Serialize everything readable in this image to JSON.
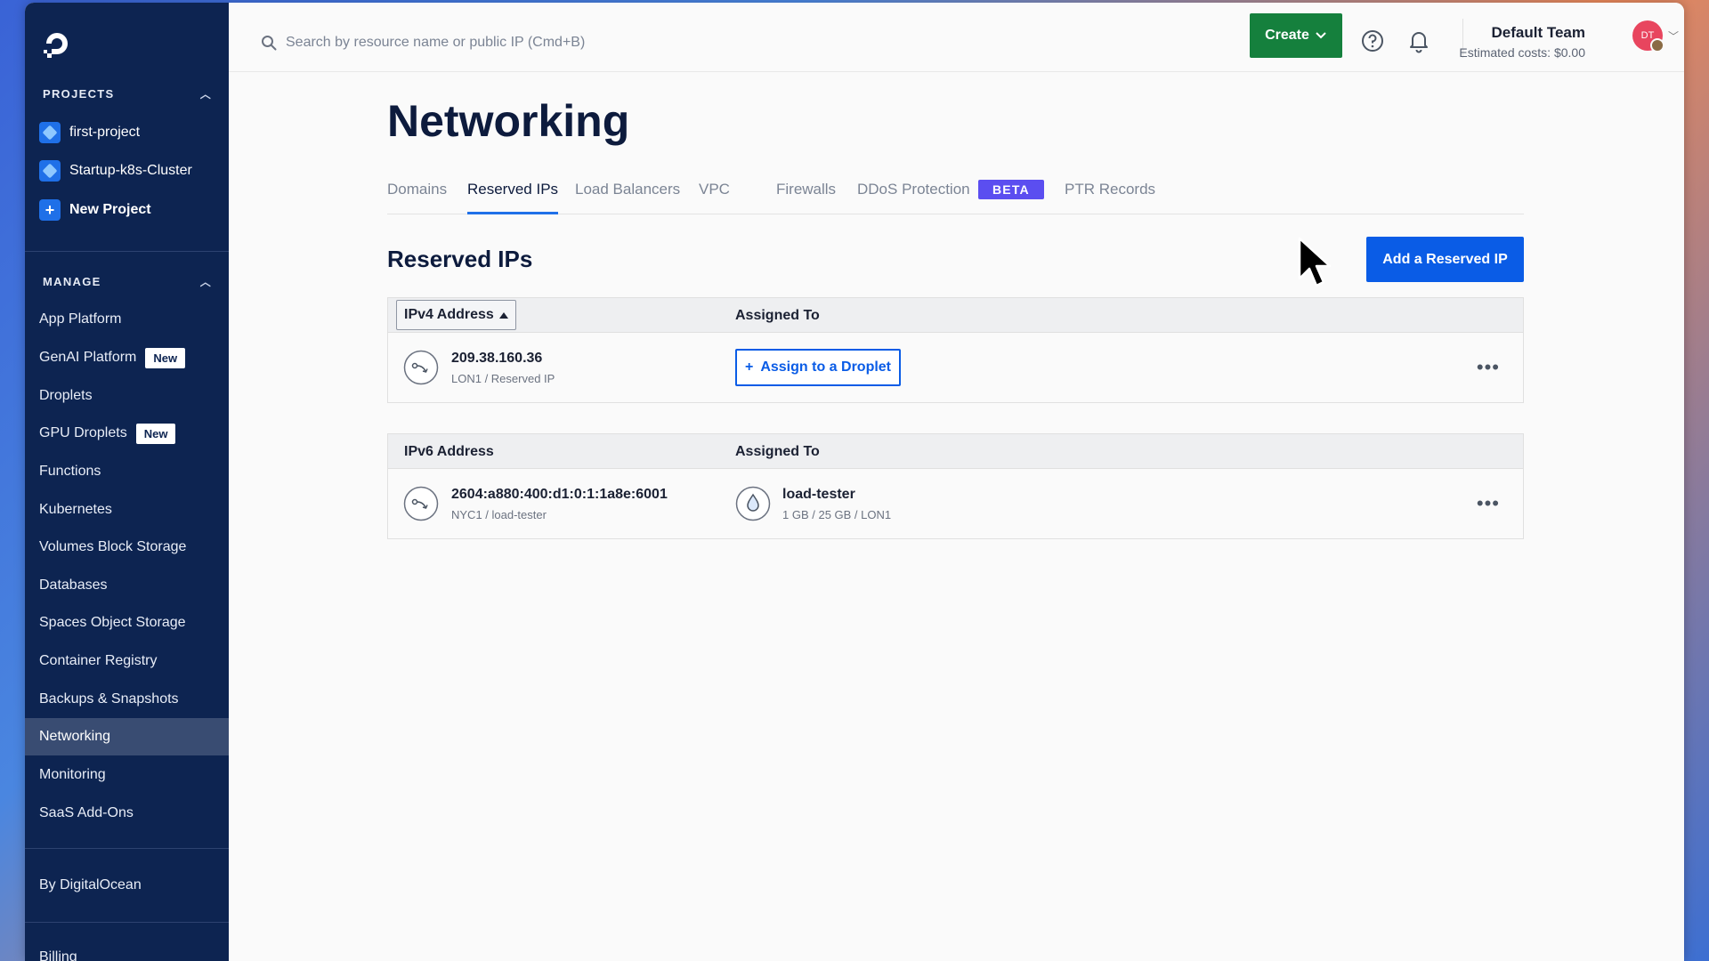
{
  "sidebar": {
    "projects_header": "PROJECTS",
    "projects": [
      {
        "label": "first-project"
      },
      {
        "label": "Startup-k8s-Cluster"
      }
    ],
    "new_project": "New Project",
    "manage_header": "MANAGE",
    "items": [
      {
        "label": "App Platform"
      },
      {
        "label": "GenAI Platform",
        "badge": "New"
      },
      {
        "label": "Droplets"
      },
      {
        "label": "GPU Droplets",
        "badge": "New"
      },
      {
        "label": "Functions"
      },
      {
        "label": "Kubernetes"
      },
      {
        "label": "Volumes Block Storage"
      },
      {
        "label": "Databases"
      },
      {
        "label": "Spaces Object Storage"
      },
      {
        "label": "Container Registry"
      },
      {
        "label": "Backups & Snapshots"
      },
      {
        "label": "Networking",
        "active": true
      },
      {
        "label": "Monitoring"
      },
      {
        "label": "SaaS Add-Ons"
      }
    ],
    "by_digitalocean": "By DigitalOcean",
    "billing": "Billing"
  },
  "topbar": {
    "search_placeholder": "Search by resource name or public IP (Cmd+B)",
    "create_label": "Create",
    "team_name": "Default Team",
    "estimated_costs": "Estimated costs: $0.00",
    "avatar_initials": "DT"
  },
  "page": {
    "title": "Networking",
    "tabs": [
      {
        "label": "Domains"
      },
      {
        "label": "Reserved IPs",
        "active": true
      },
      {
        "label": "Load Balancers"
      },
      {
        "label": "VPC"
      },
      {
        "label": "Firewalls"
      },
      {
        "label": "DDoS Protection",
        "badge": "BETA"
      },
      {
        "label": "PTR Records"
      }
    ],
    "section_title": "Reserved IPs",
    "add_button": "Add a Reserved IP"
  },
  "ipv4_table": {
    "col1": "IPv4 Address",
    "col2": "Assigned To",
    "rows": [
      {
        "ip": "209.38.160.36",
        "sub": "LON1 / Reserved IP",
        "action": "Assign to a Droplet"
      }
    ]
  },
  "ipv6_table": {
    "col1": "IPv6 Address",
    "col2": "Assigned To",
    "rows": [
      {
        "ip": "2604:a880:400:d1:0:1:1a8e:6001",
        "sub": "NYC1 / load-tester",
        "droplet": "load-tester",
        "droplet_sub": "1 GB / 25 GB / LON1"
      }
    ]
  },
  "colors": {
    "sidebar_bg": "#0d2451",
    "primary_blue": "#0a5ce6",
    "create_green": "#15803d",
    "beta_purple": "#5b4ef0"
  }
}
